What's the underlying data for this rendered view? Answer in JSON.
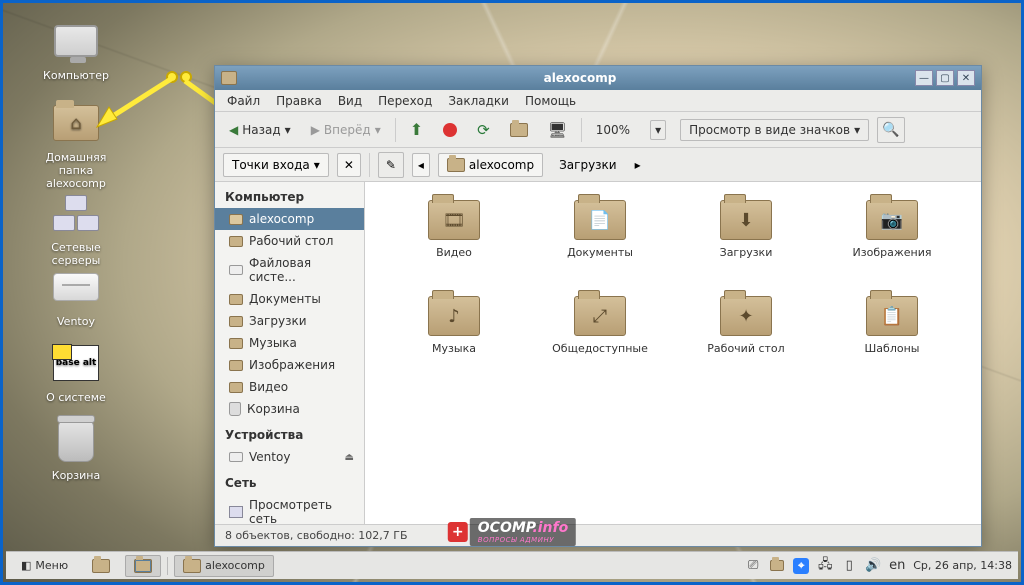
{
  "desktop_icons": [
    {
      "id": "computer",
      "label": "Компьютер"
    },
    {
      "id": "home",
      "label": "Домашняя папка alexocomp"
    },
    {
      "id": "servers",
      "label": "Сетевые серверы"
    },
    {
      "id": "ventoy",
      "label": "Ventoy"
    },
    {
      "id": "about",
      "label": "О системе",
      "logo": "base alt"
    },
    {
      "id": "trash",
      "label": "Корзина"
    }
  ],
  "fm": {
    "title": "alexocomp",
    "menu": [
      "Файл",
      "Правка",
      "Вид",
      "Переход",
      "Закладки",
      "Помощь"
    ],
    "toolbar": {
      "back": "Назад",
      "forward": "Вперёд",
      "zoom": "100%",
      "viewmode": "Просмотр в виде значков"
    },
    "location": {
      "toggle": "Точки входа",
      "crumbs": [
        "alexocomp",
        "Загрузки"
      ]
    },
    "sidebar": {
      "cat1": "Компьютер",
      "items1": [
        "alexocomp",
        "Рабочий стол",
        "Файловая систе...",
        "Документы",
        "Загрузки",
        "Музыка",
        "Изображения",
        "Видео",
        "Корзина"
      ],
      "cat2": "Устройства",
      "items2": [
        "Ventoy"
      ],
      "cat3": "Сеть",
      "items3": [
        "Просмотреть сеть"
      ]
    },
    "folders": [
      {
        "label": "Видео",
        "glyph": "🎞"
      },
      {
        "label": "Документы",
        "glyph": "📄"
      },
      {
        "label": "Загрузки",
        "glyph": "⬇"
      },
      {
        "label": "Изображения",
        "glyph": "📷"
      },
      {
        "label": "Музыка",
        "glyph": "♪"
      },
      {
        "label": "Общедоступные",
        "glyph": "⤢"
      },
      {
        "label": "Рабочий стол",
        "glyph": "✦"
      },
      {
        "label": "Шаблоны",
        "glyph": "📋"
      }
    ],
    "status": "8 объектов, свободно: 102,7 ГБ"
  },
  "taskbar": {
    "menu": "Меню",
    "task": "alexocomp",
    "lang": "en",
    "clock": "Ср, 26 апр, 14:38"
  },
  "watermark": {
    "brand": "OCOMP",
    "tld": ".info",
    "sub": "ВОПРОСЫ АДМИНУ"
  }
}
